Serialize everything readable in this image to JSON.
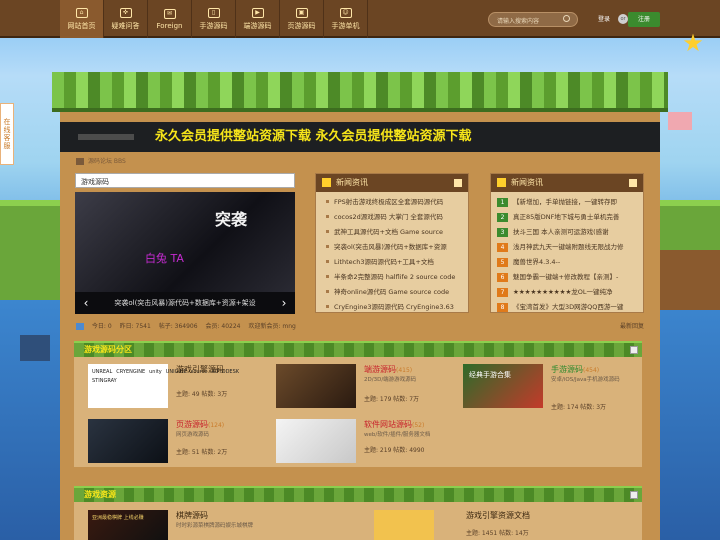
{
  "nav": {
    "items": [
      {
        "label": "网站首页",
        "icon": "home-icon"
      },
      {
        "label": "疑难问答",
        "icon": "gamepad-icon"
      },
      {
        "label": "Foreign",
        "icon": "chat-icon"
      },
      {
        "label": "手游源码",
        "icon": "phone-icon"
      },
      {
        "label": "端游源码",
        "icon": "play-icon"
      },
      {
        "label": "页游源码",
        "icon": "bag-icon"
      },
      {
        "label": "手游单机",
        "icon": "mobile-game-icon"
      }
    ]
  },
  "header": {
    "search_placeholder": "请输入搜索内容",
    "login": "登录",
    "or": "or",
    "register": "注册"
  },
  "side_tab": "在线客服",
  "banner": {
    "text": "永久会员提供整站资源下载   永久会员提供整站资源下载"
  },
  "breadcrumb": {
    "text": "源码论坛 BBS"
  },
  "slider": {
    "title": "游戏源码",
    "logo": "突袭",
    "watermark": "白兔 TA",
    "caption": "突袭ol(突击风暴)源代码+数据库+资源+架设",
    "prev": "‹",
    "next": "›"
  },
  "news_left": {
    "title": "新闻资讯",
    "items": [
      "FPS射击游戏终极成区全套源码源代码",
      "cocos2d源戏源码 大掌门 全套源代码",
      "武神工具源代码+文档 Game source",
      "突袭ol(突击风暴)源代码+数据库+资源",
      "Lithtech3源码源代码+工具+文档",
      "半条命2完整源码 halflife 2 source code",
      "神奇online源代码 Game source code",
      "CryEngine3源码源代码 CryEngine3.63"
    ]
  },
  "news_right": {
    "title": "新闻资讯",
    "items": [
      {
        "n": "1",
        "text": "【新增加，手单抛链接，一键转存即"
      },
      {
        "n": "2",
        "text": "真正85版DNF地下城与勇士单机完善"
      },
      {
        "n": "3",
        "text": "扶斗三国 本人亲测可运游戏(感谢"
      },
      {
        "n": "4",
        "text": "浅月神武九天一键端附题线无限战力修"
      },
      {
        "n": "5",
        "text": "魔兽世界4.3.4--"
      },
      {
        "n": "6",
        "text": "魅国争霸一键端+修改教程【亲测】-"
      },
      {
        "n": "7",
        "text": "★★★★★★★★★★龙OL一键纯净"
      },
      {
        "n": "8",
        "text": "《宝湾首发》大型3D网游QQ西游一键"
      }
    ]
  },
  "stats": {
    "today": "今日: 0",
    "yesterday": "昨日: 7541",
    "posts": "帖子: 364906",
    "members": "会员: 40224",
    "welcome": "欢迎新会员: mng",
    "review": "最新回复"
  },
  "section1": {
    "title": "游戏源码分区",
    "forums": [
      {
        "name": "游戏引擎源码",
        "count": "",
        "desc": "",
        "stat": "主题: 49 帖数: 3万"
      },
      {
        "name": "端游源码",
        "count": "(415)",
        "desc": "2D/3D/端游游戏源码",
        "stat": "主题: 179 帖数: 7万"
      },
      {
        "name": "手游源码",
        "count": "(454)",
        "desc": "安卓/iOS/Java手机游戏源码",
        "stat": "主题: 174 帖数: 3万"
      },
      {
        "name": "页游源码",
        "count": "(124)",
        "desc": "网页游戏源码",
        "stat": "主题: 51 帖数: 2万"
      },
      {
        "name": "软件网站源码",
        "count": "(52)",
        "desc": "web/软件/插件/服务器文档",
        "stat": "主题: 219 帖数: 4990"
      }
    ]
  },
  "section2": {
    "title": "游戏资源",
    "forums": [
      {
        "name": "棋牌源码",
        "desc": "时时彩源菜棋牌源码娱乐城棋牌",
        "stat": ""
      },
      {
        "name": "游戏引擎资源文档",
        "desc": "",
        "stat": "主题: 1451 帖数: 14万"
      }
    ],
    "thumb_text": "亚洲最稳棋牌 上线必赚"
  },
  "thumbs": {
    "engines": [
      "UNREAL",
      "CRYENGINE",
      "unity",
      "UNIGINE",
      "source",
      "AUTODESK STINGRAY"
    ],
    "game": "经典手游合集"
  },
  "colors": {
    "accent": "#f7e51a",
    "nav_bg": "#6b4523",
    "panel": "#c4914e"
  }
}
